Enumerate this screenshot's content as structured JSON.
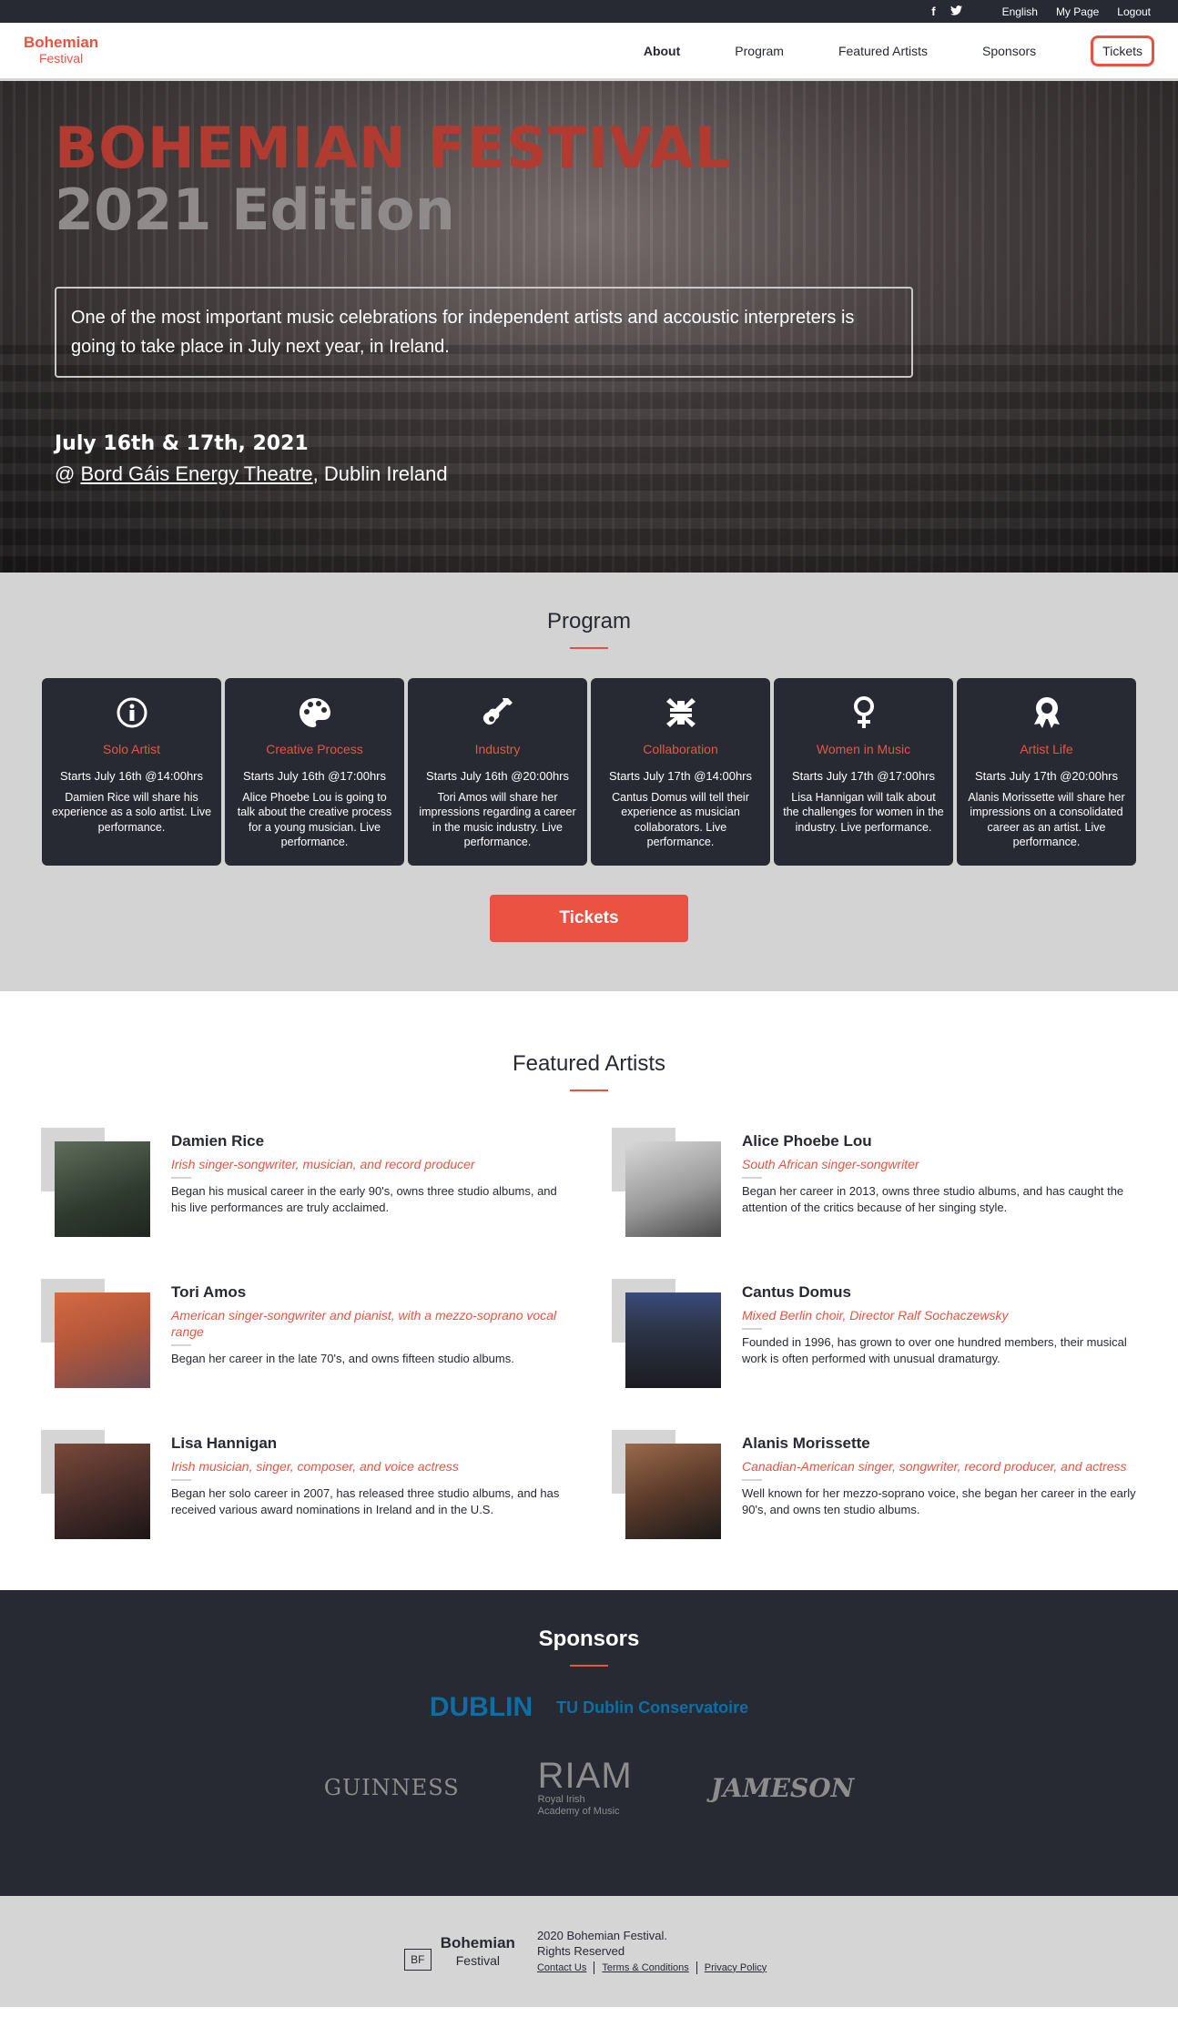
{
  "topbar": {
    "facebook": "f",
    "twitter": "🐦",
    "language": "English",
    "my_page": "My Page",
    "logout": "Logout"
  },
  "nav": {
    "logo_line1": "Bohemian",
    "logo_line2": "Festival",
    "items": [
      "About",
      "Program",
      "Featured Artists",
      "Sponsors"
    ],
    "tickets": "Tickets"
  },
  "hero": {
    "title": "BOHEMIAN FESTIVAL",
    "subtitle": "2021 Edition",
    "intro": "One of the most important music celebrations for independent artists and accoustic interpreters is going to take place in July next year, in Ireland.",
    "date": "July 16th & 17th, 2021",
    "venue_prefix": "@ ",
    "venue_link": "Bord Gáis Energy Theatre",
    "venue_suffix": ", Dublin Ireland"
  },
  "program": {
    "title": "Program",
    "cards": [
      {
        "icon": "info-icon",
        "title": "Solo Artist",
        "time": "Starts July 16th @14:00hrs",
        "desc": "Damien Rice will share his experience as a solo artist. Live performance."
      },
      {
        "icon": "palette-icon",
        "title": "Creative Process",
        "time": "Starts July 16th @17:00hrs",
        "desc": "Alice Phoebe Lou is going to talk about the creative process for a young musician. Live performance."
      },
      {
        "icon": "guitar-icon",
        "title": "Industry",
        "time": "Starts July 16th @20:00hrs",
        "desc": "Tori Amos will share her impressions regarding a career in the music industry. Live performance."
      },
      {
        "icon": "compress-icon",
        "title": "Collaboration",
        "time": "Starts July 17th @14:00hrs",
        "desc": "Cantus Domus will tell their experience as musician collaborators. Live performance."
      },
      {
        "icon": "venus-icon",
        "title": "Women in Music",
        "time": "Starts July 17th @17:00hrs",
        "desc": "Lisa Hannigan will talk about the challenges for women in the industry. Live performance."
      },
      {
        "icon": "award-icon",
        "title": "Artist Life",
        "time": "Starts July 17th @20:00hrs",
        "desc": "Alanis Morissette will share her impressions on a consolidated career as an artist. Live performance."
      }
    ],
    "tickets_button": "Tickets"
  },
  "featured": {
    "title": "Featured Artists",
    "artists": [
      {
        "name": "Damien Rice",
        "role": "Irish singer-songwriter, musician, and record producer",
        "bio": "Began his musical career in the early 90's, owns three studio albums, and his live performances are truly acclaimed.",
        "color": "#3a4a3a"
      },
      {
        "name": "Alice Phoebe Lou",
        "role": "South African singer-songwriter",
        "bio": "Began her career in 2013, owns three studio albums, and has caught the attention of the critics because of her singing style.",
        "color": "#9a9a9a"
      },
      {
        "name": "Tori Amos",
        "role": "American singer-songwriter and pianist, with a mezzo-soprano vocal range",
        "bio": "Began her career in the late 70's, and owns fifteen studio albums.",
        "color": "#b4573a"
      },
      {
        "name": "Cantus Domus",
        "role": "Mixed Berlin choir, Director Ralf Sochaczewsky",
        "bio": "Founded in 1996, has grown to over one hundred members, their musical work is often performed with unusual dramaturgy.",
        "color": "#2c3446"
      },
      {
        "name": "Lisa Hannigan",
        "role": "Irish musician, singer, composer, and voice actress",
        "bio": "Began her solo career in 2007, has released three studio albums, and has received various award nominations in Ireland and in the U.S.",
        "color": "#4a2e2a"
      },
      {
        "name": "Alanis Morissette",
        "role": "Canadian-American singer, songwriter, record producer, and actress",
        "bio": "Well known for her mezzo-soprano voice, she began her career in the early 90's, and owns ten studio albums.",
        "color": "#5a3a2a"
      }
    ]
  },
  "sponsors": {
    "title": "Sponsors",
    "tu_logo": "DUBLIN",
    "tu_name": "TU Dublin Conservatoire",
    "guinness": "GUINNESS",
    "riam_big": "RIAM",
    "riam_small1": "Royal Irish",
    "riam_small2": "Academy of Music",
    "jameson": "JAMESON"
  },
  "footer": {
    "bf": "BF",
    "logo1": "Bohemian",
    "logo2": "Festival",
    "copyright1": "2020 Bohemian Festival.",
    "copyright2": "Rights Reserved",
    "links": [
      "Contact Us",
      "Terms & Conditions",
      "Privacy Policy"
    ]
  }
}
